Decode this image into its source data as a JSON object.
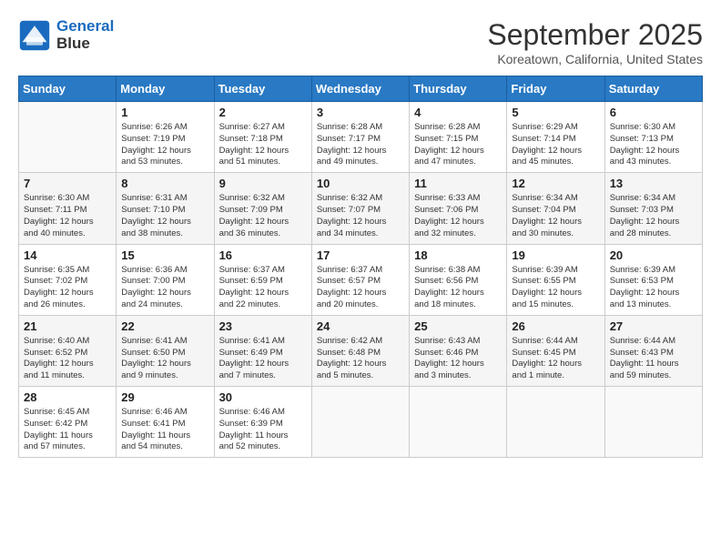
{
  "header": {
    "logo_line1": "General",
    "logo_line2": "Blue",
    "month": "September 2025",
    "location": "Koreatown, California, United States"
  },
  "days_of_week": [
    "Sunday",
    "Monday",
    "Tuesday",
    "Wednesday",
    "Thursday",
    "Friday",
    "Saturday"
  ],
  "weeks": [
    [
      {
        "day": null,
        "info": null
      },
      {
        "day": "1",
        "info": "Sunrise: 6:26 AM\nSunset: 7:19 PM\nDaylight: 12 hours\nand 53 minutes."
      },
      {
        "day": "2",
        "info": "Sunrise: 6:27 AM\nSunset: 7:18 PM\nDaylight: 12 hours\nand 51 minutes."
      },
      {
        "day": "3",
        "info": "Sunrise: 6:28 AM\nSunset: 7:17 PM\nDaylight: 12 hours\nand 49 minutes."
      },
      {
        "day": "4",
        "info": "Sunrise: 6:28 AM\nSunset: 7:15 PM\nDaylight: 12 hours\nand 47 minutes."
      },
      {
        "day": "5",
        "info": "Sunrise: 6:29 AM\nSunset: 7:14 PM\nDaylight: 12 hours\nand 45 minutes."
      },
      {
        "day": "6",
        "info": "Sunrise: 6:30 AM\nSunset: 7:13 PM\nDaylight: 12 hours\nand 43 minutes."
      }
    ],
    [
      {
        "day": "7",
        "info": "Sunrise: 6:30 AM\nSunset: 7:11 PM\nDaylight: 12 hours\nand 40 minutes."
      },
      {
        "day": "8",
        "info": "Sunrise: 6:31 AM\nSunset: 7:10 PM\nDaylight: 12 hours\nand 38 minutes."
      },
      {
        "day": "9",
        "info": "Sunrise: 6:32 AM\nSunset: 7:09 PM\nDaylight: 12 hours\nand 36 minutes."
      },
      {
        "day": "10",
        "info": "Sunrise: 6:32 AM\nSunset: 7:07 PM\nDaylight: 12 hours\nand 34 minutes."
      },
      {
        "day": "11",
        "info": "Sunrise: 6:33 AM\nSunset: 7:06 PM\nDaylight: 12 hours\nand 32 minutes."
      },
      {
        "day": "12",
        "info": "Sunrise: 6:34 AM\nSunset: 7:04 PM\nDaylight: 12 hours\nand 30 minutes."
      },
      {
        "day": "13",
        "info": "Sunrise: 6:34 AM\nSunset: 7:03 PM\nDaylight: 12 hours\nand 28 minutes."
      }
    ],
    [
      {
        "day": "14",
        "info": "Sunrise: 6:35 AM\nSunset: 7:02 PM\nDaylight: 12 hours\nand 26 minutes."
      },
      {
        "day": "15",
        "info": "Sunrise: 6:36 AM\nSunset: 7:00 PM\nDaylight: 12 hours\nand 24 minutes."
      },
      {
        "day": "16",
        "info": "Sunrise: 6:37 AM\nSunset: 6:59 PM\nDaylight: 12 hours\nand 22 minutes."
      },
      {
        "day": "17",
        "info": "Sunrise: 6:37 AM\nSunset: 6:57 PM\nDaylight: 12 hours\nand 20 minutes."
      },
      {
        "day": "18",
        "info": "Sunrise: 6:38 AM\nSunset: 6:56 PM\nDaylight: 12 hours\nand 18 minutes."
      },
      {
        "day": "19",
        "info": "Sunrise: 6:39 AM\nSunset: 6:55 PM\nDaylight: 12 hours\nand 15 minutes."
      },
      {
        "day": "20",
        "info": "Sunrise: 6:39 AM\nSunset: 6:53 PM\nDaylight: 12 hours\nand 13 minutes."
      }
    ],
    [
      {
        "day": "21",
        "info": "Sunrise: 6:40 AM\nSunset: 6:52 PM\nDaylight: 12 hours\nand 11 minutes."
      },
      {
        "day": "22",
        "info": "Sunrise: 6:41 AM\nSunset: 6:50 PM\nDaylight: 12 hours\nand 9 minutes."
      },
      {
        "day": "23",
        "info": "Sunrise: 6:41 AM\nSunset: 6:49 PM\nDaylight: 12 hours\nand 7 minutes."
      },
      {
        "day": "24",
        "info": "Sunrise: 6:42 AM\nSunset: 6:48 PM\nDaylight: 12 hours\nand 5 minutes."
      },
      {
        "day": "25",
        "info": "Sunrise: 6:43 AM\nSunset: 6:46 PM\nDaylight: 12 hours\nand 3 minutes."
      },
      {
        "day": "26",
        "info": "Sunrise: 6:44 AM\nSunset: 6:45 PM\nDaylight: 12 hours\nand 1 minute."
      },
      {
        "day": "27",
        "info": "Sunrise: 6:44 AM\nSunset: 6:43 PM\nDaylight: 11 hours\nand 59 minutes."
      }
    ],
    [
      {
        "day": "28",
        "info": "Sunrise: 6:45 AM\nSunset: 6:42 PM\nDaylight: 11 hours\nand 57 minutes."
      },
      {
        "day": "29",
        "info": "Sunrise: 6:46 AM\nSunset: 6:41 PM\nDaylight: 11 hours\nand 54 minutes."
      },
      {
        "day": "30",
        "info": "Sunrise: 6:46 AM\nSunset: 6:39 PM\nDaylight: 11 hours\nand 52 minutes."
      },
      {
        "day": null,
        "info": null
      },
      {
        "day": null,
        "info": null
      },
      {
        "day": null,
        "info": null
      },
      {
        "day": null,
        "info": null
      }
    ]
  ]
}
